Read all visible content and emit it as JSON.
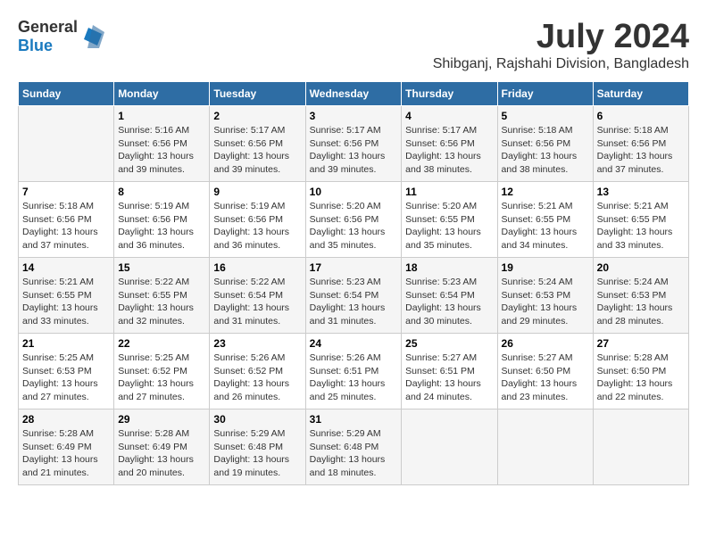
{
  "header": {
    "logo_general": "General",
    "logo_blue": "Blue",
    "title": "July 2024",
    "subtitle": "Shibganj, Rajshahi Division, Bangladesh"
  },
  "days_of_week": [
    "Sunday",
    "Monday",
    "Tuesday",
    "Wednesday",
    "Thursday",
    "Friday",
    "Saturday"
  ],
  "weeks": [
    [
      {
        "day": "",
        "info": ""
      },
      {
        "day": "1",
        "info": "Sunrise: 5:16 AM\nSunset: 6:56 PM\nDaylight: 13 hours\nand 39 minutes."
      },
      {
        "day": "2",
        "info": "Sunrise: 5:17 AM\nSunset: 6:56 PM\nDaylight: 13 hours\nand 39 minutes."
      },
      {
        "day": "3",
        "info": "Sunrise: 5:17 AM\nSunset: 6:56 PM\nDaylight: 13 hours\nand 39 minutes."
      },
      {
        "day": "4",
        "info": "Sunrise: 5:17 AM\nSunset: 6:56 PM\nDaylight: 13 hours\nand 38 minutes."
      },
      {
        "day": "5",
        "info": "Sunrise: 5:18 AM\nSunset: 6:56 PM\nDaylight: 13 hours\nand 38 minutes."
      },
      {
        "day": "6",
        "info": "Sunrise: 5:18 AM\nSunset: 6:56 PM\nDaylight: 13 hours\nand 37 minutes."
      }
    ],
    [
      {
        "day": "7",
        "info": "Sunrise: 5:18 AM\nSunset: 6:56 PM\nDaylight: 13 hours\nand 37 minutes."
      },
      {
        "day": "8",
        "info": "Sunrise: 5:19 AM\nSunset: 6:56 PM\nDaylight: 13 hours\nand 36 minutes."
      },
      {
        "day": "9",
        "info": "Sunrise: 5:19 AM\nSunset: 6:56 PM\nDaylight: 13 hours\nand 36 minutes."
      },
      {
        "day": "10",
        "info": "Sunrise: 5:20 AM\nSunset: 6:56 PM\nDaylight: 13 hours\nand 35 minutes."
      },
      {
        "day": "11",
        "info": "Sunrise: 5:20 AM\nSunset: 6:55 PM\nDaylight: 13 hours\nand 35 minutes."
      },
      {
        "day": "12",
        "info": "Sunrise: 5:21 AM\nSunset: 6:55 PM\nDaylight: 13 hours\nand 34 minutes."
      },
      {
        "day": "13",
        "info": "Sunrise: 5:21 AM\nSunset: 6:55 PM\nDaylight: 13 hours\nand 33 minutes."
      }
    ],
    [
      {
        "day": "14",
        "info": "Sunrise: 5:21 AM\nSunset: 6:55 PM\nDaylight: 13 hours\nand 33 minutes."
      },
      {
        "day": "15",
        "info": "Sunrise: 5:22 AM\nSunset: 6:55 PM\nDaylight: 13 hours\nand 32 minutes."
      },
      {
        "day": "16",
        "info": "Sunrise: 5:22 AM\nSunset: 6:54 PM\nDaylight: 13 hours\nand 31 minutes."
      },
      {
        "day": "17",
        "info": "Sunrise: 5:23 AM\nSunset: 6:54 PM\nDaylight: 13 hours\nand 31 minutes."
      },
      {
        "day": "18",
        "info": "Sunrise: 5:23 AM\nSunset: 6:54 PM\nDaylight: 13 hours\nand 30 minutes."
      },
      {
        "day": "19",
        "info": "Sunrise: 5:24 AM\nSunset: 6:53 PM\nDaylight: 13 hours\nand 29 minutes."
      },
      {
        "day": "20",
        "info": "Sunrise: 5:24 AM\nSunset: 6:53 PM\nDaylight: 13 hours\nand 28 minutes."
      }
    ],
    [
      {
        "day": "21",
        "info": "Sunrise: 5:25 AM\nSunset: 6:53 PM\nDaylight: 13 hours\nand 27 minutes."
      },
      {
        "day": "22",
        "info": "Sunrise: 5:25 AM\nSunset: 6:52 PM\nDaylight: 13 hours\nand 27 minutes."
      },
      {
        "day": "23",
        "info": "Sunrise: 5:26 AM\nSunset: 6:52 PM\nDaylight: 13 hours\nand 26 minutes."
      },
      {
        "day": "24",
        "info": "Sunrise: 5:26 AM\nSunset: 6:51 PM\nDaylight: 13 hours\nand 25 minutes."
      },
      {
        "day": "25",
        "info": "Sunrise: 5:27 AM\nSunset: 6:51 PM\nDaylight: 13 hours\nand 24 minutes."
      },
      {
        "day": "26",
        "info": "Sunrise: 5:27 AM\nSunset: 6:50 PM\nDaylight: 13 hours\nand 23 minutes."
      },
      {
        "day": "27",
        "info": "Sunrise: 5:28 AM\nSunset: 6:50 PM\nDaylight: 13 hours\nand 22 minutes."
      }
    ],
    [
      {
        "day": "28",
        "info": "Sunrise: 5:28 AM\nSunset: 6:49 PM\nDaylight: 13 hours\nand 21 minutes."
      },
      {
        "day": "29",
        "info": "Sunrise: 5:28 AM\nSunset: 6:49 PM\nDaylight: 13 hours\nand 20 minutes."
      },
      {
        "day": "30",
        "info": "Sunrise: 5:29 AM\nSunset: 6:48 PM\nDaylight: 13 hours\nand 19 minutes."
      },
      {
        "day": "31",
        "info": "Sunrise: 5:29 AM\nSunset: 6:48 PM\nDaylight: 13 hours\nand 18 minutes."
      },
      {
        "day": "",
        "info": ""
      },
      {
        "day": "",
        "info": ""
      },
      {
        "day": "",
        "info": ""
      }
    ]
  ]
}
